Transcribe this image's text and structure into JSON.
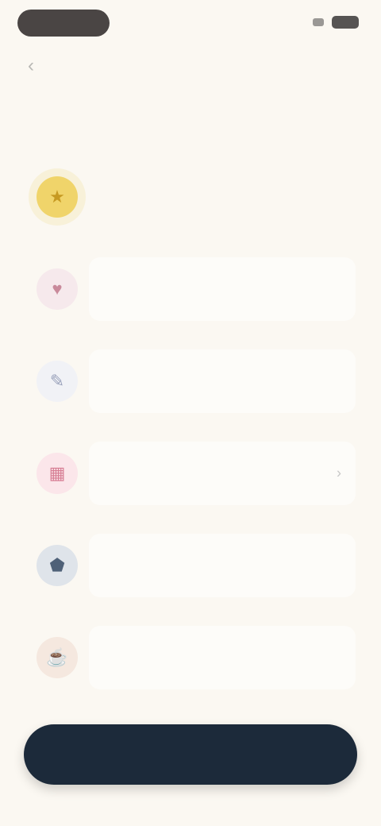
{
  "status_bar": {
    "time": "",
    "signal_icon": "signal-icon",
    "battery_icon": "battery-icon"
  },
  "nav": {
    "back_icon": "chevron-left-icon",
    "link_label": ""
  },
  "heading": "",
  "items": [
    {
      "title": "",
      "subtitle": "",
      "subtitle_accent": "",
      "icon": "star-icon",
      "color": "#f0d46a",
      "selected": true
    },
    {
      "title": "",
      "icon": "heart-icon",
      "color": "#c98a9b",
      "selected": false
    },
    {
      "title": "",
      "icon": "feather-icon",
      "color": "#b9bfd3",
      "selected": false
    },
    {
      "title": "",
      "icon": "calendar-icon",
      "color": "#e59aac",
      "selected": false
    },
    {
      "title": "",
      "icon": "shield-icon",
      "color": "#5d6f86",
      "selected": false
    },
    {
      "title": "",
      "icon": "cup-icon",
      "color": "#c9a08a",
      "selected": false
    }
  ],
  "cta": {
    "label": ""
  }
}
